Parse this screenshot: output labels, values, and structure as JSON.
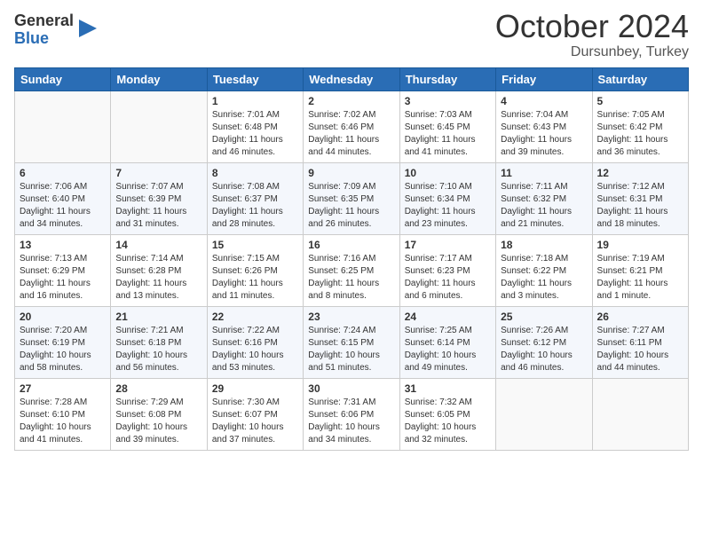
{
  "header": {
    "logo_general": "General",
    "logo_blue": "Blue",
    "month_title": "October 2024",
    "subtitle": "Dursunbey, Turkey"
  },
  "days_of_week": [
    "Sunday",
    "Monday",
    "Tuesday",
    "Wednesday",
    "Thursday",
    "Friday",
    "Saturday"
  ],
  "weeks": [
    [
      {
        "day": null,
        "info": ""
      },
      {
        "day": null,
        "info": ""
      },
      {
        "day": "1",
        "sunrise": "7:01 AM",
        "sunset": "6:48 PM",
        "daylight": "11 hours and 46 minutes."
      },
      {
        "day": "2",
        "sunrise": "7:02 AM",
        "sunset": "6:46 PM",
        "daylight": "11 hours and 44 minutes."
      },
      {
        "day": "3",
        "sunrise": "7:03 AM",
        "sunset": "6:45 PM",
        "daylight": "11 hours and 41 minutes."
      },
      {
        "day": "4",
        "sunrise": "7:04 AM",
        "sunset": "6:43 PM",
        "daylight": "11 hours and 39 minutes."
      },
      {
        "day": "5",
        "sunrise": "7:05 AM",
        "sunset": "6:42 PM",
        "daylight": "11 hours and 36 minutes."
      }
    ],
    [
      {
        "day": "6",
        "sunrise": "7:06 AM",
        "sunset": "6:40 PM",
        "daylight": "11 hours and 34 minutes."
      },
      {
        "day": "7",
        "sunrise": "7:07 AM",
        "sunset": "6:39 PM",
        "daylight": "11 hours and 31 minutes."
      },
      {
        "day": "8",
        "sunrise": "7:08 AM",
        "sunset": "6:37 PM",
        "daylight": "11 hours and 28 minutes."
      },
      {
        "day": "9",
        "sunrise": "7:09 AM",
        "sunset": "6:35 PM",
        "daylight": "11 hours and 26 minutes."
      },
      {
        "day": "10",
        "sunrise": "7:10 AM",
        "sunset": "6:34 PM",
        "daylight": "11 hours and 23 minutes."
      },
      {
        "day": "11",
        "sunrise": "7:11 AM",
        "sunset": "6:32 PM",
        "daylight": "11 hours and 21 minutes."
      },
      {
        "day": "12",
        "sunrise": "7:12 AM",
        "sunset": "6:31 PM",
        "daylight": "11 hours and 18 minutes."
      }
    ],
    [
      {
        "day": "13",
        "sunrise": "7:13 AM",
        "sunset": "6:29 PM",
        "daylight": "11 hours and 16 minutes."
      },
      {
        "day": "14",
        "sunrise": "7:14 AM",
        "sunset": "6:28 PM",
        "daylight": "11 hours and 13 minutes."
      },
      {
        "day": "15",
        "sunrise": "7:15 AM",
        "sunset": "6:26 PM",
        "daylight": "11 hours and 11 minutes."
      },
      {
        "day": "16",
        "sunrise": "7:16 AM",
        "sunset": "6:25 PM",
        "daylight": "11 hours and 8 minutes."
      },
      {
        "day": "17",
        "sunrise": "7:17 AM",
        "sunset": "6:23 PM",
        "daylight": "11 hours and 6 minutes."
      },
      {
        "day": "18",
        "sunrise": "7:18 AM",
        "sunset": "6:22 PM",
        "daylight": "11 hours and 3 minutes."
      },
      {
        "day": "19",
        "sunrise": "7:19 AM",
        "sunset": "6:21 PM",
        "daylight": "11 hours and 1 minute."
      }
    ],
    [
      {
        "day": "20",
        "sunrise": "7:20 AM",
        "sunset": "6:19 PM",
        "daylight": "10 hours and 58 minutes."
      },
      {
        "day": "21",
        "sunrise": "7:21 AM",
        "sunset": "6:18 PM",
        "daylight": "10 hours and 56 minutes."
      },
      {
        "day": "22",
        "sunrise": "7:22 AM",
        "sunset": "6:16 PM",
        "daylight": "10 hours and 53 minutes."
      },
      {
        "day": "23",
        "sunrise": "7:24 AM",
        "sunset": "6:15 PM",
        "daylight": "10 hours and 51 minutes."
      },
      {
        "day": "24",
        "sunrise": "7:25 AM",
        "sunset": "6:14 PM",
        "daylight": "10 hours and 49 minutes."
      },
      {
        "day": "25",
        "sunrise": "7:26 AM",
        "sunset": "6:12 PM",
        "daylight": "10 hours and 46 minutes."
      },
      {
        "day": "26",
        "sunrise": "7:27 AM",
        "sunset": "6:11 PM",
        "daylight": "10 hours and 44 minutes."
      }
    ],
    [
      {
        "day": "27",
        "sunrise": "7:28 AM",
        "sunset": "6:10 PM",
        "daylight": "10 hours and 41 minutes."
      },
      {
        "day": "28",
        "sunrise": "7:29 AM",
        "sunset": "6:08 PM",
        "daylight": "10 hours and 39 minutes."
      },
      {
        "day": "29",
        "sunrise": "7:30 AM",
        "sunset": "6:07 PM",
        "daylight": "10 hours and 37 minutes."
      },
      {
        "day": "30",
        "sunrise": "7:31 AM",
        "sunset": "6:06 PM",
        "daylight": "10 hours and 34 minutes."
      },
      {
        "day": "31",
        "sunrise": "7:32 AM",
        "sunset": "6:05 PM",
        "daylight": "10 hours and 32 minutes."
      },
      {
        "day": null,
        "info": ""
      },
      {
        "day": null,
        "info": ""
      }
    ]
  ],
  "labels": {
    "sunrise": "Sunrise:",
    "sunset": "Sunset:",
    "daylight": "Daylight:"
  }
}
